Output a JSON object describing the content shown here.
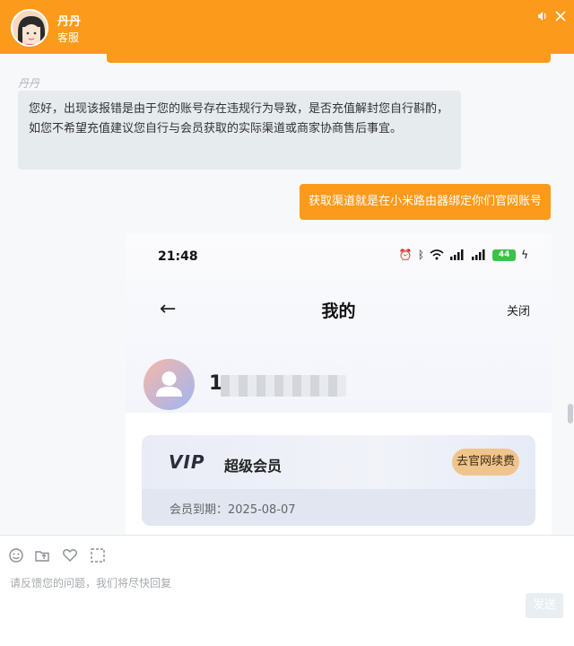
{
  "header": {
    "agent_name": "丹丹",
    "agent_role": "客服"
  },
  "chat": {
    "agent_label": "丹丹",
    "agent_message": "您好，出现该报错是由于您的账号存在违规行为导致，是否充值解封您自行斟酌，如您不希望充值建议您自行与会员获取的实际渠道或商家协商售后事宜。",
    "user_message": "获取渠道就是在小米路由器绑定你们官网账号"
  },
  "screenshot": {
    "status_time": "21:48",
    "battery": "44",
    "back_icon": "←",
    "page_title": "我的",
    "close_label": "关闭",
    "user_id_visible": "1",
    "vip_logo": "VIP",
    "vip_name": "超级会员",
    "renew_button": "去官网续费",
    "expiry_text": "会员到期：2025-08-07"
  },
  "input": {
    "placeholder": "请反馈您的问题，我们将尽快回复",
    "send_label": "发送"
  },
  "colors": {
    "brand_orange": "#fb9a1b",
    "agent_bubble": "#e6ebee"
  }
}
